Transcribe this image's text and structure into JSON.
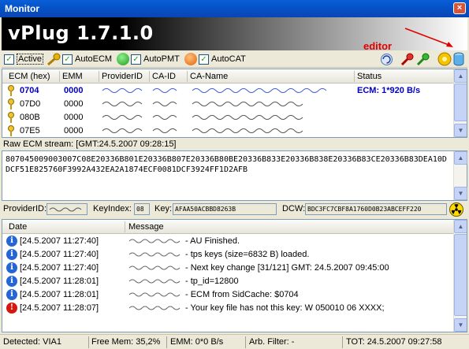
{
  "window": {
    "title": "Monitor",
    "close_glyph": "×"
  },
  "banner": {
    "app_title": "vPlug 1.7.1.0",
    "annotation": "editor",
    "annotation_color": "#e00000"
  },
  "toolbar": {
    "active_label": "Active",
    "autoecm_label": "AutoECM",
    "autopmt_label": "AutoPMT",
    "autocat_label": "AutoCAT",
    "icons": [
      "key-icon",
      "green-circle-icon",
      "orange-circle-icon",
      "reload-icon",
      "red-key-icon",
      "green-key-icon",
      "star-icon",
      "database-icon"
    ]
  },
  "ecm_table": {
    "headers": [
      "ECM (hex)",
      "EMM",
      "ProviderID",
      "CA-ID",
      "CA-Name",
      "Status"
    ],
    "rows": [
      {
        "ecm": "0704",
        "emm": "0000",
        "status": "ECM: 1*920 B/s",
        "selected": true
      },
      {
        "ecm": "07D0",
        "emm": "0000",
        "status": "",
        "selected": false
      },
      {
        "ecm": "080B",
        "emm": "0000",
        "status": "",
        "selected": false
      },
      {
        "ecm": "07E5",
        "emm": "0000",
        "status": "",
        "selected": false
      }
    ]
  },
  "raw_ecm": {
    "label": "Raw ECM stream: [GMT:24.5.2007 09:28:15]",
    "data": "807045009003007C08E20336B801E20336B807E20336B80BE20336B833E20336B838E20336B83CE20336B83DEA10DDCF51E825760F3992A432EA2A1874ECF0081DCF3924FF1D2AFB"
  },
  "info": {
    "provider_label": "ProviderID:",
    "keyindex_label": "KeyIndex:",
    "keyindex_value": "08",
    "key_label": "Key:",
    "key_value": "AFAA50ACBBD8263B",
    "dcw_label": "DCW:",
    "dcw_value": "BDC3FC7CBF8A1760D0B23ABCEFF220"
  },
  "log": {
    "headers": [
      "Date",
      "Message"
    ],
    "rows": [
      {
        "type": "info",
        "date": "[24.5.2007 11:27:40]",
        "message": "- AU Finished."
      },
      {
        "type": "info",
        "date": "[24.5.2007 11:27:40]",
        "message": "- tps keys (size=6832 B) loaded."
      },
      {
        "type": "info",
        "date": "[24.5.2007 11:27:40]",
        "message": "- Next key change [31/121] GMT: 24.5.2007 09:45:00"
      },
      {
        "type": "info",
        "date": "[24.5.2007 11:28:01]",
        "message": "- tp_id=12800"
      },
      {
        "type": "info",
        "date": "[24.5.2007 11:28:01]",
        "message": "- ECM from SidCache: $0704"
      },
      {
        "type": "err",
        "date": "[24.5.2007 11:28:07]",
        "message": "- Your key file has not this key: W 050010 06 XXXX;"
      }
    ],
    "info_glyph": "i",
    "error_glyph": "!"
  },
  "statusbar": {
    "detected": "Detected: VIA1",
    "free_mem": "Free Mem: 35,2%",
    "emm": "EMM: 0*0 B/s",
    "filter": "Arb. Filter: -",
    "tot": "TOT: 24.5.2007 09:27:58"
  }
}
